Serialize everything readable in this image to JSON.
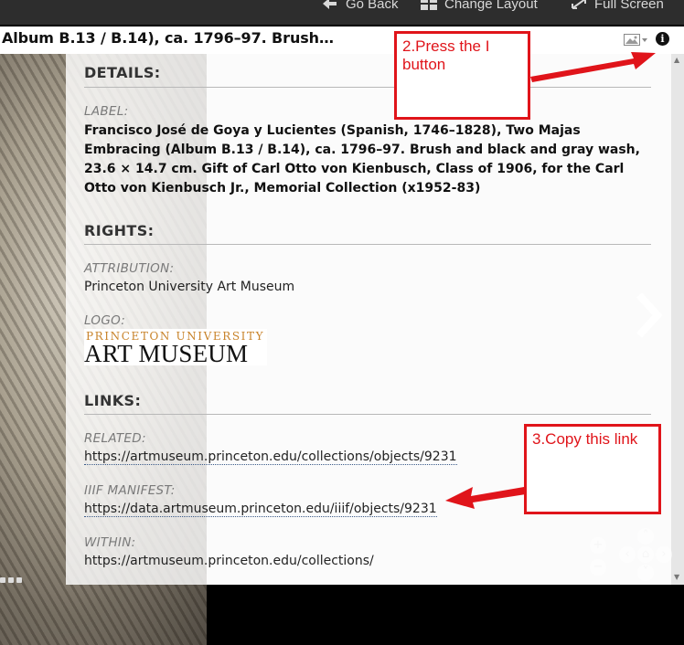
{
  "toolbar": {
    "go_back": "Go Back",
    "change_layout": "Change Layout",
    "full_screen": "Full Screen"
  },
  "title": "Album B.13 / B.14), ca. 1796–97. Brush…",
  "panel": {
    "details_heading": "DETAILS:",
    "label_label": "LABEL:",
    "label_value": "Francisco José de Goya y Lucientes (Spanish, 1746–1828), Two Majas Embracing (Album B.13 / B.14), ca. 1796–97. Brush and black and gray wash, 23.6 × 14.7 cm. Gift of Carl Otto von Kienbusch, Class of 1906, for the Carl Otto von Kienbusch Jr., Memorial Collection (x1952-83)",
    "rights_heading": "RIGHTS:",
    "attribution_label": "ATTRIBUTION:",
    "attribution_value": "Princeton University Art Museum",
    "logo_label": "LOGO:",
    "logo_line1": "PRINCETON UNIVERSITY",
    "logo_line2": "ART MUSEUM",
    "links_heading": "LINKS:",
    "related_label": "RELATED:",
    "related_value": "https://artmuseum.princeton.edu/collections/objects/9231",
    "manifest_label": "IIIF MANIFEST:",
    "manifest_value": "https://data.artmuseum.princeton.edu/iiif/objects/9231",
    "within_label": "WITHIN:",
    "within_value": "https://artmuseum.princeton.edu/collections/"
  },
  "annotations": {
    "press_i": "2.Press the I button",
    "copy_link": "3.Copy this link"
  },
  "colors": {
    "annotation_red": "#e0141a",
    "logo_orange": "#c8832a"
  }
}
